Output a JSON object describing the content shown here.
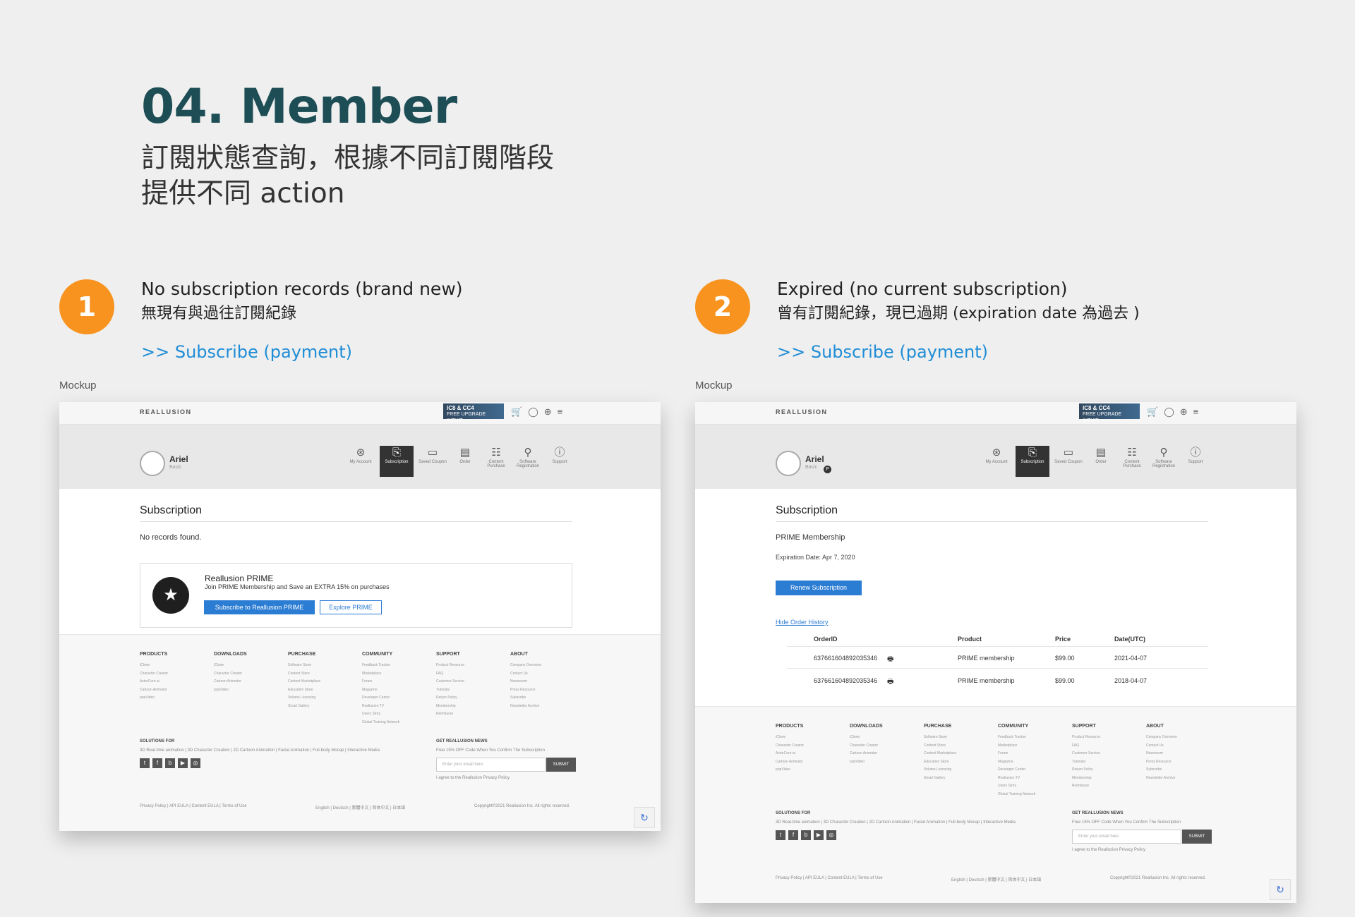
{
  "heading": {
    "title": "04. Member",
    "subtitle_line1": "訂閱狀態查詢，根據不同訂閱階段",
    "subtitle_line2": "提供不同 action"
  },
  "cases": [
    {
      "number": "1",
      "line1": "No subscription records (brand new)",
      "line2": "無現有與過往訂閱紀錄",
      "link": ">> Subscribe (payment)",
      "mockup_label": "Mockup"
    },
    {
      "number": "2",
      "line1": "Expired (no current subscription)",
      "line2": "曾有訂閱紀錄，現已過期 (expiration date 為過去 )",
      "link": ">> Subscribe (payment)",
      "mockup_label": "Mockup"
    }
  ],
  "mock_common": {
    "logo": "REALLUSION",
    "promo_line1": "IC8 & CC4",
    "promo_line2": "FREE UPGRADE INTUIT",
    "user_name": "Ariel",
    "user_sub": "Basic",
    "tabs": [
      {
        "label": "My Account",
        "icon": "user-circle-icon"
      },
      {
        "label": "Subscription",
        "icon": "subscription-icon"
      },
      {
        "label": "Saved Coupon",
        "icon": "coupon-icon"
      },
      {
        "label": "Order",
        "icon": "order-icon"
      },
      {
        "label": "Content Purchase",
        "icon": "list-icon"
      },
      {
        "label": "Software Registration",
        "icon": "register-icon"
      },
      {
        "label": "Support",
        "icon": "info-icon"
      }
    ],
    "subscription_title": "Subscription",
    "footer": {
      "columns": [
        {
          "title": "PRODUCTS",
          "items": [
            "iClone",
            "Character Creator",
            "ActorCore ai",
            "Cartoon Animator",
            "popVideo"
          ]
        },
        {
          "title": "DOWNLOADS",
          "items": [
            "iClone",
            "Character Creator",
            "Cartoon Animator",
            "popVideo"
          ]
        },
        {
          "title": "PURCHASE",
          "items": [
            "Software Store",
            "Content Store",
            "Content Marketplace",
            "Education Store",
            "Volume Licensing",
            "Smart Gallery"
          ]
        },
        {
          "title": "COMMUNITY",
          "items": [
            "Feedback Tracker",
            "Marketplace",
            "Forum",
            "Magazine",
            "Developer Center",
            "Reallusion TV",
            "Users Story",
            "Global Training Network"
          ]
        },
        {
          "title": "SUPPORT",
          "items": [
            "Product Resource",
            "FAQ",
            "Customer Service",
            "Tutorials",
            "Return Policy",
            "Membership",
            "Reimburse"
          ]
        },
        {
          "title": "ABOUT",
          "items": [
            "Company Overview",
            "Contact Us",
            "Newsroom",
            "Press Resource",
            "Subscribe",
            "Newsletter Archive"
          ]
        }
      ],
      "solutions_title": "SOLUTIONS FOR",
      "solutions_text": "3D Real-time animation | 3D Character Creation | 2D Cartoon Animation | Facial Animation | Full-body Mocap | Interactive Media",
      "news_title": "GET REALLUSION NEWS",
      "news_text": "Free 15% OFF Code When You Confirm The Subscription",
      "email_placeholder": "Enter your email here",
      "submit": "SUBMIT",
      "agree": "I agree to the Reallusion Privacy Policy",
      "legal": "Privacy Policy | API EULA | Content EULA | Terms of Use",
      "languages": "English | Deutsch | 繁體中文 | 简体中文 | 日本語",
      "copyright": "Copyright©2021 Reallusion Inc. All rights reserved."
    }
  },
  "mock1": {
    "no_records": "No records found.",
    "prime_title": "Reallusion PRIME",
    "prime_desc": "Join PRIME Membership and Save an EXTRA 15% on purchases",
    "subscribe_btn": "Subscribe to Reallusion PRIME",
    "explore_btn": "Explore PRIME"
  },
  "mock2": {
    "membership": "PRIME Membership",
    "expiration": "Expiration Date: Apr 7, 2020",
    "renew_btn": "Renew Subscription",
    "hide_history": "Hide Order History",
    "table": {
      "headers": [
        "OrderID",
        "Product",
        "Price",
        "Date(UTC)"
      ],
      "rows": [
        [
          "637661604892035346",
          "PRIME membership",
          "$99.00",
          "2021-04-07"
        ],
        [
          "637661604892035346",
          "PRIME membership",
          "$99.00",
          "2018-04-07"
        ]
      ]
    }
  }
}
